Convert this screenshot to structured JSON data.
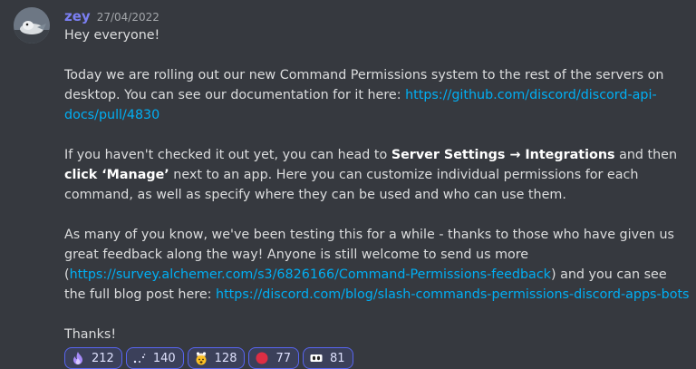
{
  "message": {
    "author": "zey",
    "timestamp": "27/04/2022",
    "greeting": "Hey everyone!",
    "p1_text": "Today we are rolling out our new Command Permissions system to the rest of the servers on desktop. You can see our documentation for it here: ",
    "p1_link": "https://github.com/discord/discord-api-docs/pull/4830",
    "p2_a": "If you haven't checked it out yet, you can head to ",
    "p2_bold1": "Server Settings → Integrations",
    "p2_b": " and then ",
    "p2_bold2": "click ‘Manage’",
    "p2_c": " next to an app. Here you can customize individual permissions for each command, as well as specify where they can be used and who can use them.",
    "p3_a": "As many of you know, we've been testing this for a while - thanks to those who have given us great feedback along the way! Anyone is still welcome to send us more (",
    "p3_link1": "https://survey.alchemer.com/s3/6826166/Command-Permissions-feedback",
    "p3_b": ") and you can see the full blog post here: ",
    "p3_link2": "https://discord.com/blog/slash-commands-permissions-discord-apps-bots",
    "closing": "Thanks!"
  },
  "reactions": [
    {
      "icon": "purple-flame-icon",
      "count": "212"
    },
    {
      "icon": "sparkle-dots-icon",
      "count": "140"
    },
    {
      "icon": "mind-blown-icon",
      "count": "128"
    },
    {
      "icon": "red-circle-icon",
      "count": "77"
    },
    {
      "icon": "eyes-icon",
      "count": "81"
    }
  ],
  "colors": {
    "background": "#36393f",
    "username": "#7b7ff3",
    "link": "#00aff4",
    "reaction_border": "#5865f2",
    "reaction_bg": "#3b405a"
  }
}
